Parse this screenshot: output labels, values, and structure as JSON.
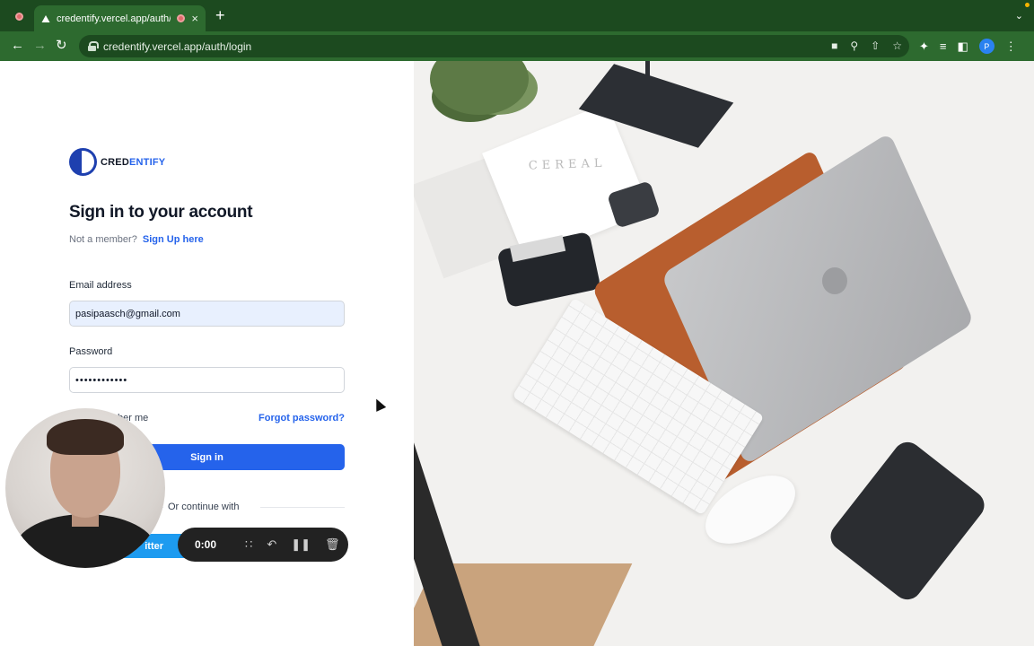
{
  "browser": {
    "tab_title": "credentify.vercel.app/auth/l",
    "tab_close": "×",
    "new_tab": "+",
    "url": "credentify.vercel.app/auth/login",
    "profile_initial": "P",
    "accent_color": "#2d6a2f"
  },
  "logo": {
    "part1": "CRED",
    "part2": "ENTIFY"
  },
  "form": {
    "heading": "Sign in to your account",
    "not_member": "Not a member?",
    "signup_link": "Sign Up here",
    "email_label": "Email address",
    "email_value": "pasipaasch@gmail.com",
    "password_label": "Password",
    "password_value": "••••••••••••",
    "remember_me": "ber me",
    "forgot_password": "Forgot password?",
    "signin_button": "Sign in",
    "divider_text": "Or continue with",
    "twitter_button": "itter"
  },
  "recorder": {
    "time": "0:00"
  },
  "photo": {
    "book_text": "CEREAL"
  }
}
